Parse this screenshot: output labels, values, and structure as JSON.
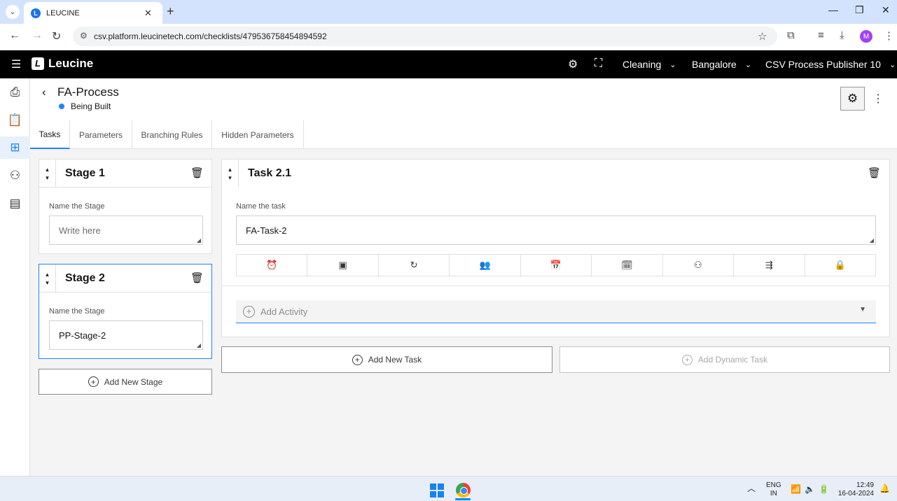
{
  "browser": {
    "tab_title": "LEUCINE",
    "tab_favicon": "L",
    "url": "csv.platform.leucinetech.com/checklists/479536758454894592",
    "profile_initial": "M"
  },
  "header": {
    "brand": "Leucine",
    "brand_mark": "L",
    "facility_select": "Cleaning",
    "site_select": "Bangalore",
    "user_select": "CSV Process Publisher 10"
  },
  "page": {
    "title": "FA-Process",
    "status": "Being Built",
    "status_color": "#1d84ff"
  },
  "tabs": [
    {
      "label": "Tasks"
    },
    {
      "label": "Parameters"
    },
    {
      "label": "Branching Rules"
    },
    {
      "label": "Hidden Parameters"
    }
  ],
  "stages": [
    {
      "title": "Stage 1",
      "name_label": "Name the Stage",
      "value": "",
      "placeholder": "Write here"
    },
    {
      "title": "Stage 2",
      "name_label": "Name the Stage",
      "value": "PP-Stage-2",
      "placeholder": ""
    }
  ],
  "add_stage_label": "Add New Stage",
  "task": {
    "title": "Task 2.1",
    "name_label": "Name the task",
    "value": "FA-Task-2",
    "tools": [
      "alarm-clock-icon",
      "image-icon",
      "refresh-icon",
      "assign-users-icon",
      "schedule-calendar-icon",
      "calendar-clock-icon",
      "branch-icon",
      "flow-icon",
      "clipboard-lock-icon"
    ],
    "add_activity_label": "Add Activity"
  },
  "add_task_label": "Add New Task",
  "add_dynamic_task_label": "Add Dynamic Task",
  "system_tray": {
    "lang_top": "ENG",
    "lang_bottom": "IN",
    "time": "12:49",
    "date": "16-04-2024"
  },
  "colors": {
    "accent": "#1d84ff",
    "header_bg": "#000000",
    "chrome_tabstrip": "#d3e3fd"
  }
}
